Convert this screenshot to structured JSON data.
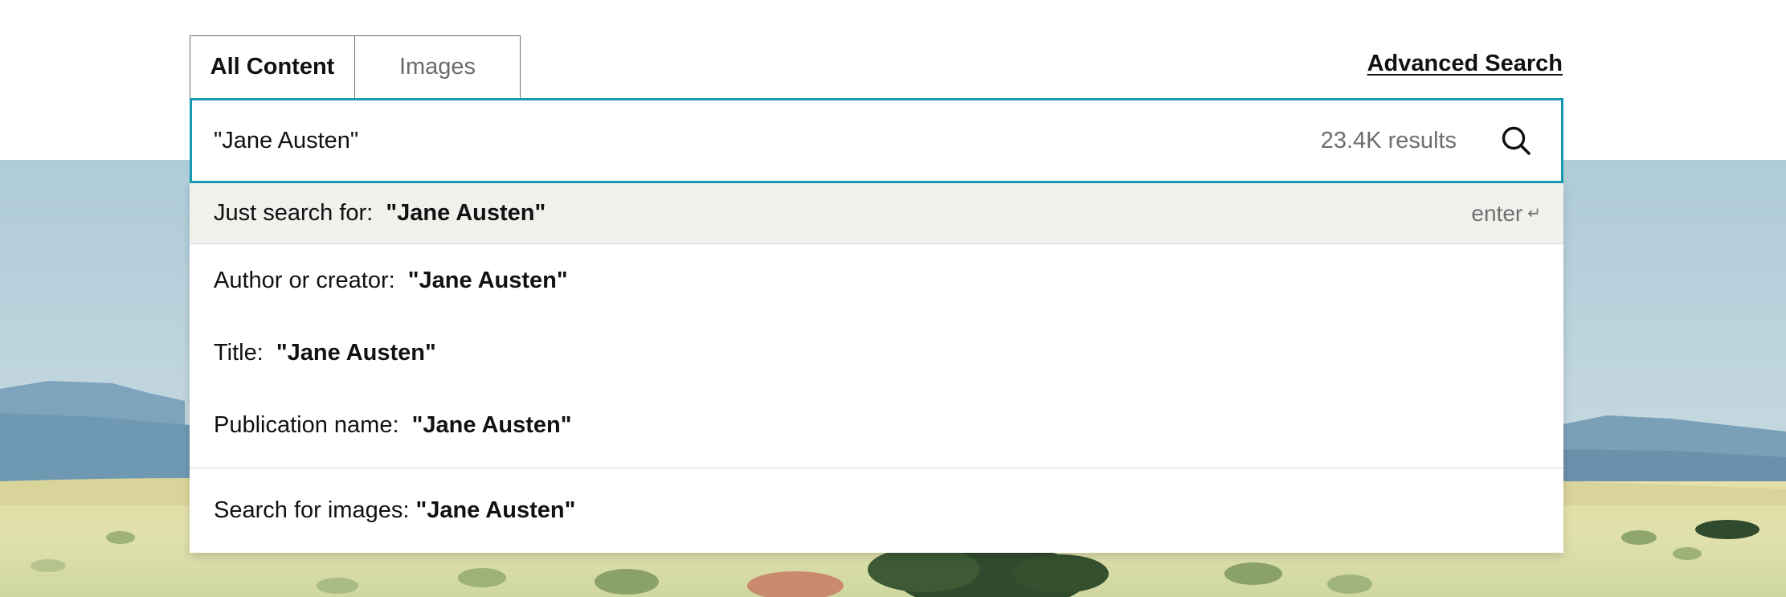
{
  "tabs": {
    "all_content": "All Content",
    "images": "Images"
  },
  "advanced_search": "Advanced Search",
  "search": {
    "query": "\"Jane Austen\"",
    "result_count": "23.4K results",
    "icon": "search-icon"
  },
  "suggestions": {
    "just_search": {
      "prefix": "Just search for:  ",
      "term": "\"Jane Austen\"",
      "hint": "enter",
      "hint_icon": "↵"
    },
    "author": {
      "prefix": "Author or creator:  ",
      "term": "\"Jane Austen\""
    },
    "title": {
      "prefix": "Title:  ",
      "term": "\"Jane Austen\""
    },
    "publication": {
      "prefix": "Publication name:  ",
      "term": "\"Jane Austen\""
    },
    "images": {
      "prefix": "Search for images: ",
      "term": "\"Jane Austen\""
    }
  },
  "colors": {
    "accent": "#1799b3",
    "highlight_row": "#f1f0ed",
    "muted_text": "#6e6e6e"
  }
}
